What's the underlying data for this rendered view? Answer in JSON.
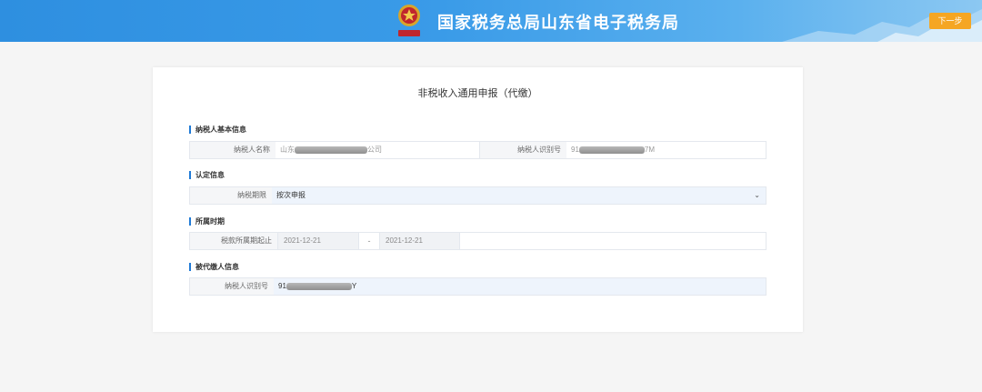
{
  "header": {
    "title": "国家税务总局山东省电子税务局",
    "next_label": "下一步",
    "emblem_icon": "tax-emblem-icon",
    "bg_color": "#3a9be8",
    "next_color": "#f5a623"
  },
  "form": {
    "title": "非税收入通用申报（代缴）",
    "sections": {
      "basic": {
        "heading": "纳税人基本信息",
        "name_label": "纳税人名称",
        "name_prefix": "山东",
        "name_suffix": "公司",
        "id_label": "纳税人识别号",
        "id_prefix": "91",
        "id_suffix": "7M"
      },
      "determination": {
        "heading": "认定信息",
        "period_label": "纳税期限",
        "period_value": "按次申报"
      },
      "period": {
        "heading": "所属时期",
        "range_label": "税款所属期起止",
        "start": "2021-12-21",
        "separator": "-",
        "end": "2021-12-21"
      },
      "payee": {
        "heading": "被代缴人信息",
        "id_label": "纳税人识别号",
        "id_prefix": "91",
        "id_suffix": "Y"
      }
    }
  },
  "accent_color": "#1f7ad6"
}
